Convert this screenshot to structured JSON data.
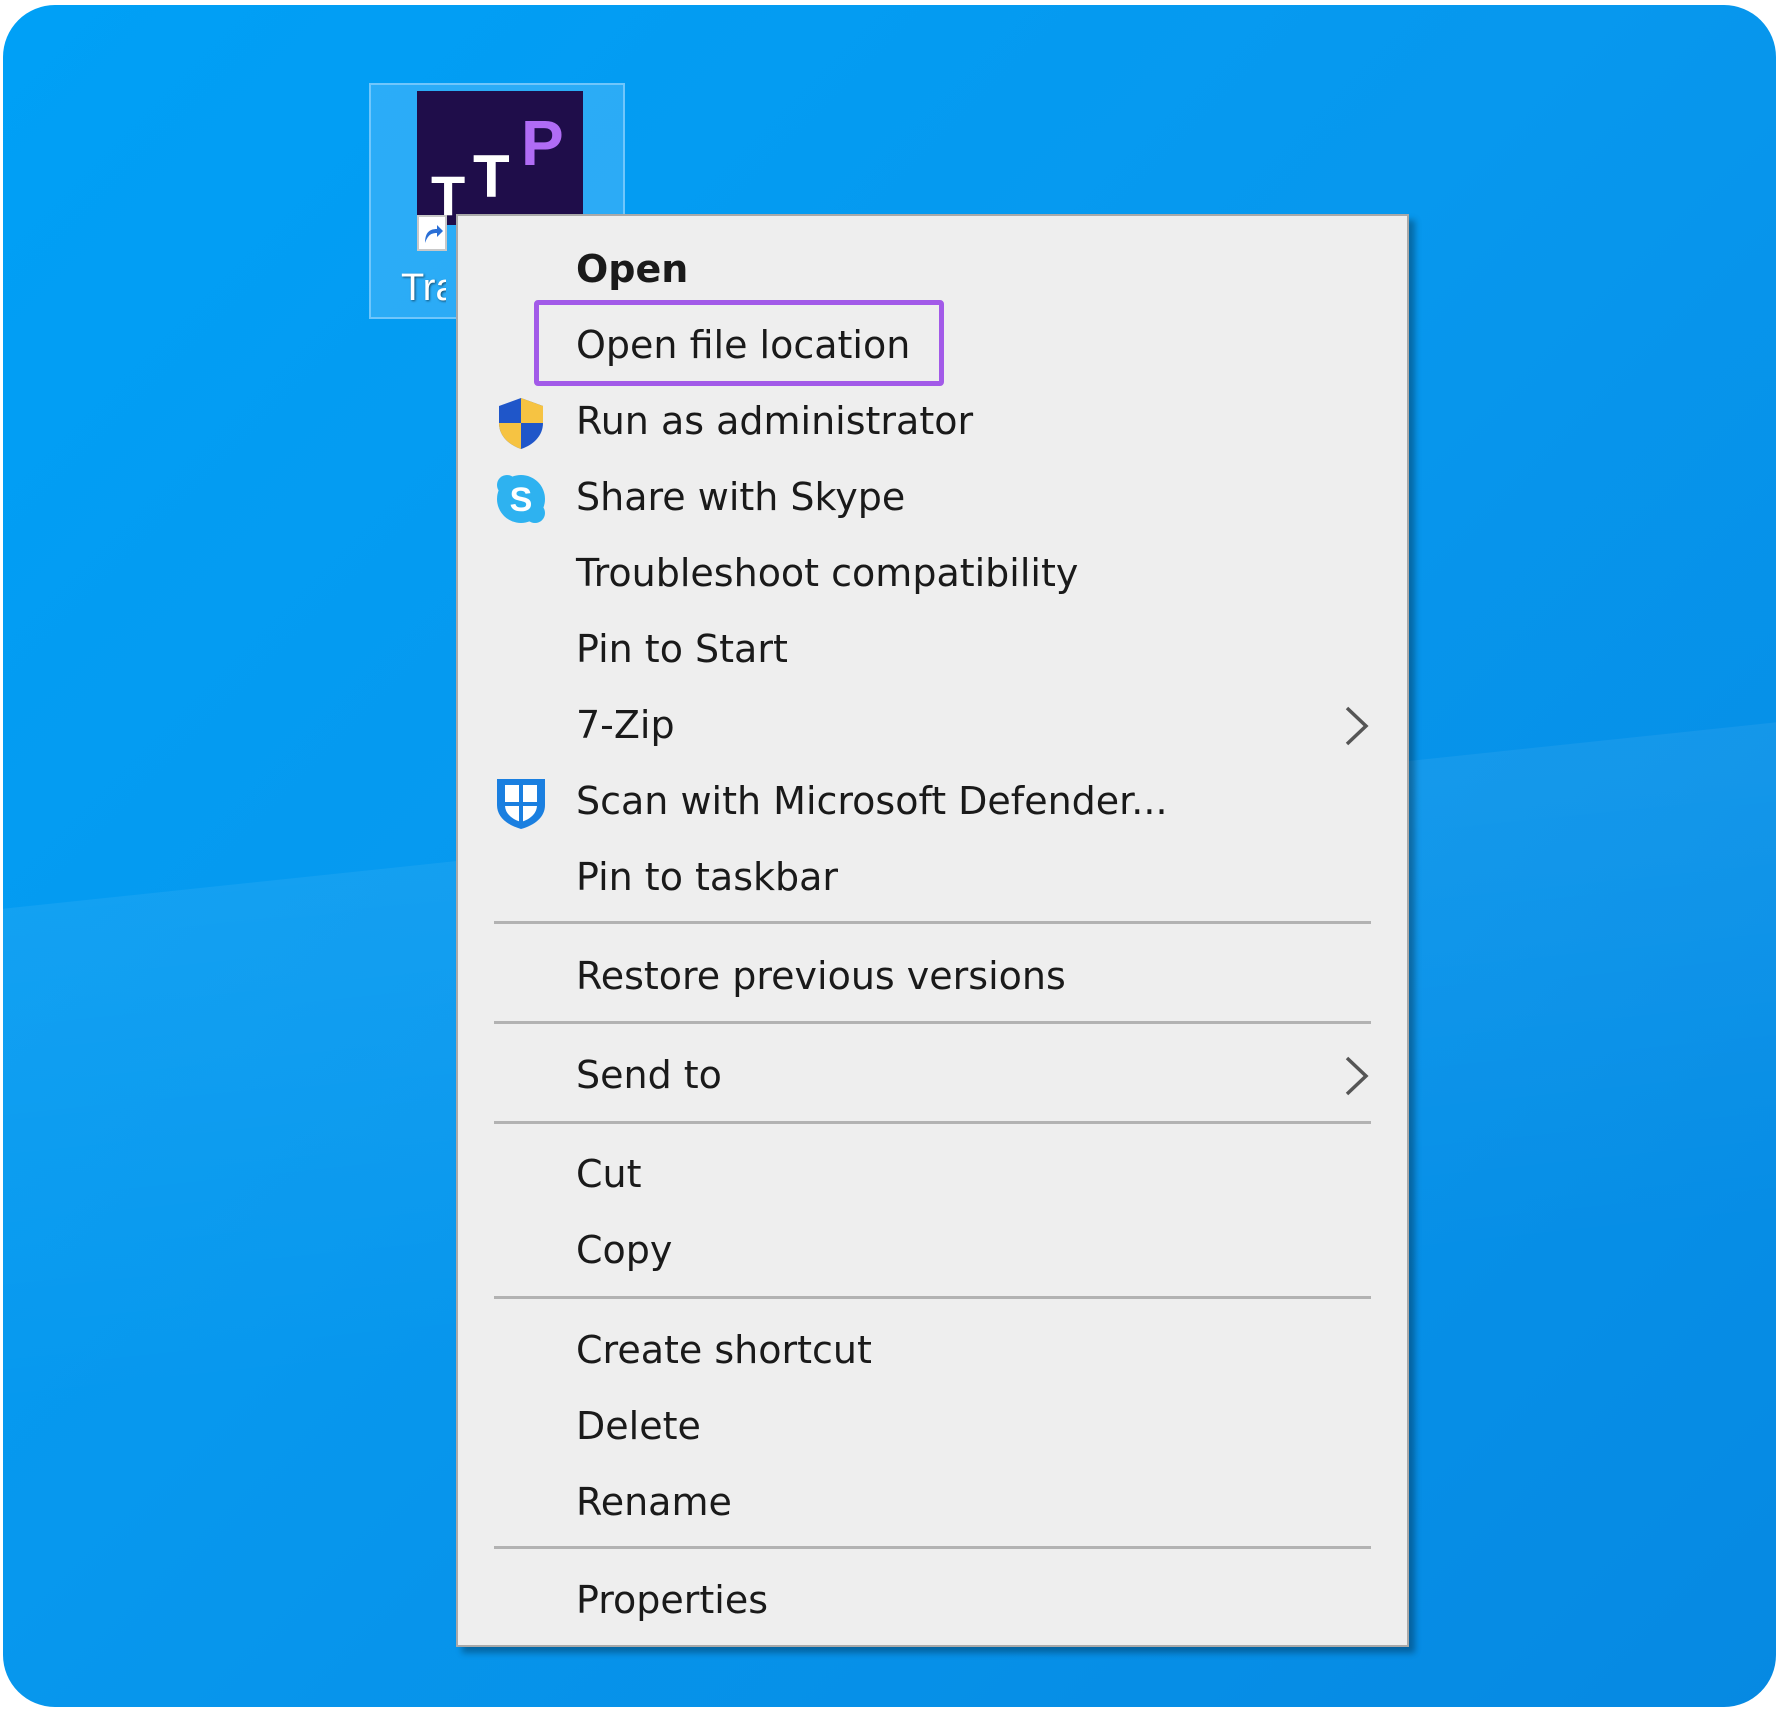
{
  "desktop": {
    "icon": {
      "tile_letters": [
        "T",
        "T",
        "P"
      ],
      "label": "Tra",
      "selected": true
    }
  },
  "context_menu": {
    "items": [
      {
        "label": "Open",
        "bold": true,
        "icon": null,
        "submenu": false
      },
      {
        "label": "Open file location",
        "bold": false,
        "icon": null,
        "submenu": false,
        "highlighted": true
      },
      {
        "label": "Run as administrator",
        "bold": false,
        "icon": "uac-shield-icon",
        "submenu": false
      },
      {
        "label": "Share with Skype",
        "bold": false,
        "icon": "skype-icon",
        "submenu": false
      },
      {
        "label": "Troubleshoot compatibility",
        "bold": false,
        "icon": null,
        "submenu": false
      },
      {
        "label": "Pin to Start",
        "bold": false,
        "icon": null,
        "submenu": false
      },
      {
        "label": "7-Zip",
        "bold": false,
        "icon": null,
        "submenu": true
      },
      {
        "label": "Scan with Microsoft Defender...",
        "bold": false,
        "icon": "defender-shield-icon",
        "submenu": false
      },
      {
        "label": "Pin to taskbar",
        "bold": false,
        "icon": null,
        "submenu": false
      },
      {
        "label": "Restore previous versions",
        "bold": false,
        "icon": null,
        "submenu": false
      },
      {
        "label": "Send to",
        "bold": false,
        "icon": null,
        "submenu": true
      },
      {
        "label": "Cut",
        "bold": false,
        "icon": null,
        "submenu": false
      },
      {
        "label": "Copy",
        "bold": false,
        "icon": null,
        "submenu": false
      },
      {
        "label": "Create shortcut",
        "bold": false,
        "icon": null,
        "submenu": false
      },
      {
        "label": "Delete",
        "bold": false,
        "icon": null,
        "submenu": false
      },
      {
        "label": "Rename",
        "bold": false,
        "icon": null,
        "submenu": false
      },
      {
        "label": "Properties",
        "bold": false,
        "icon": null,
        "submenu": false
      }
    ]
  },
  "colors": {
    "desktop_background": "#0798ee",
    "menu_background": "#eeeeee",
    "highlight_border": "#a25ae8",
    "app_tile_background": "#1f0d4a",
    "app_tile_accent": "#b06cf5"
  }
}
